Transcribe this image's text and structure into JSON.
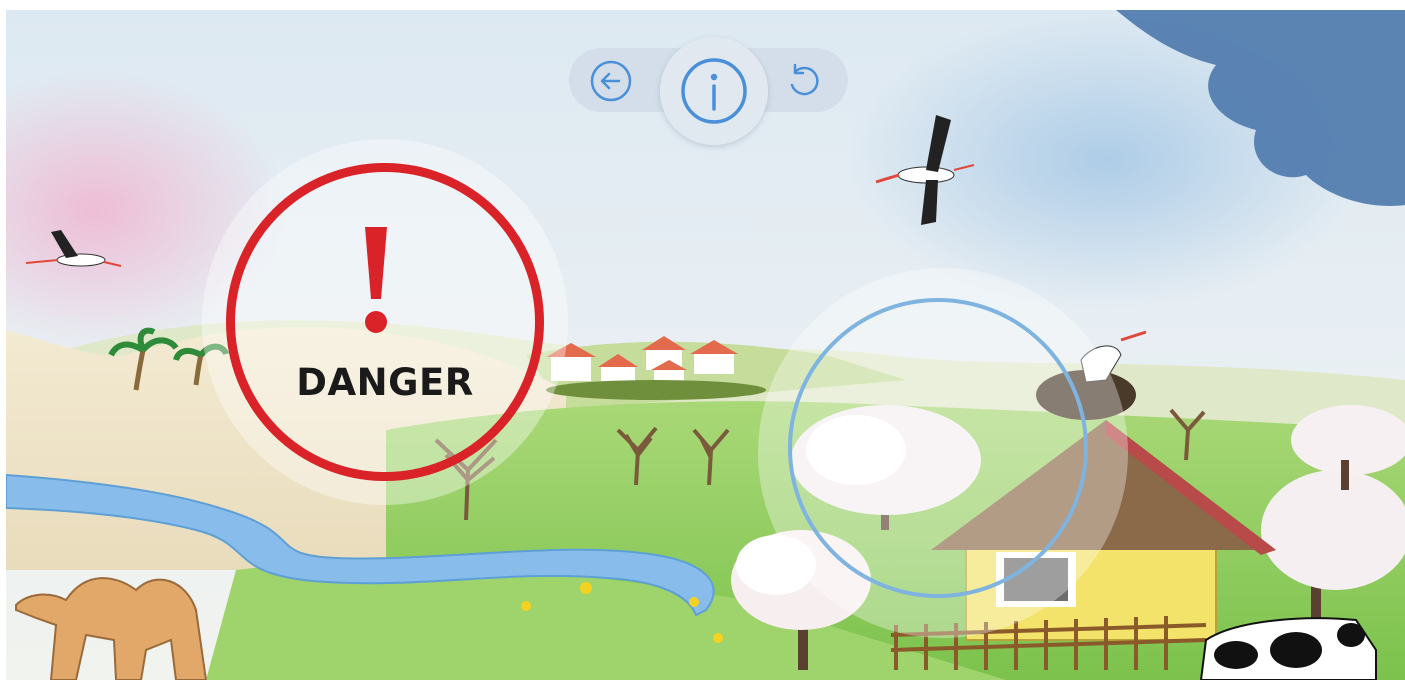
{
  "toolbar": {
    "back_icon": "arrow-left-icon",
    "info_icon": "info-icon",
    "reset_icon": "reset-icon",
    "accent_color": "#4a90d9"
  },
  "danger_hotspot": {
    "text": "DANGER",
    "icon": "exclamation-icon",
    "color": "#d92328"
  },
  "target_hotspot": {
    "ring_color": "#7fb3e0"
  },
  "scene": {
    "sky_color": "#cfe2ef",
    "meadow_color": "#8ec95a",
    "river_color": "#7fb6e6",
    "desert_color": "#f1e6c8"
  }
}
